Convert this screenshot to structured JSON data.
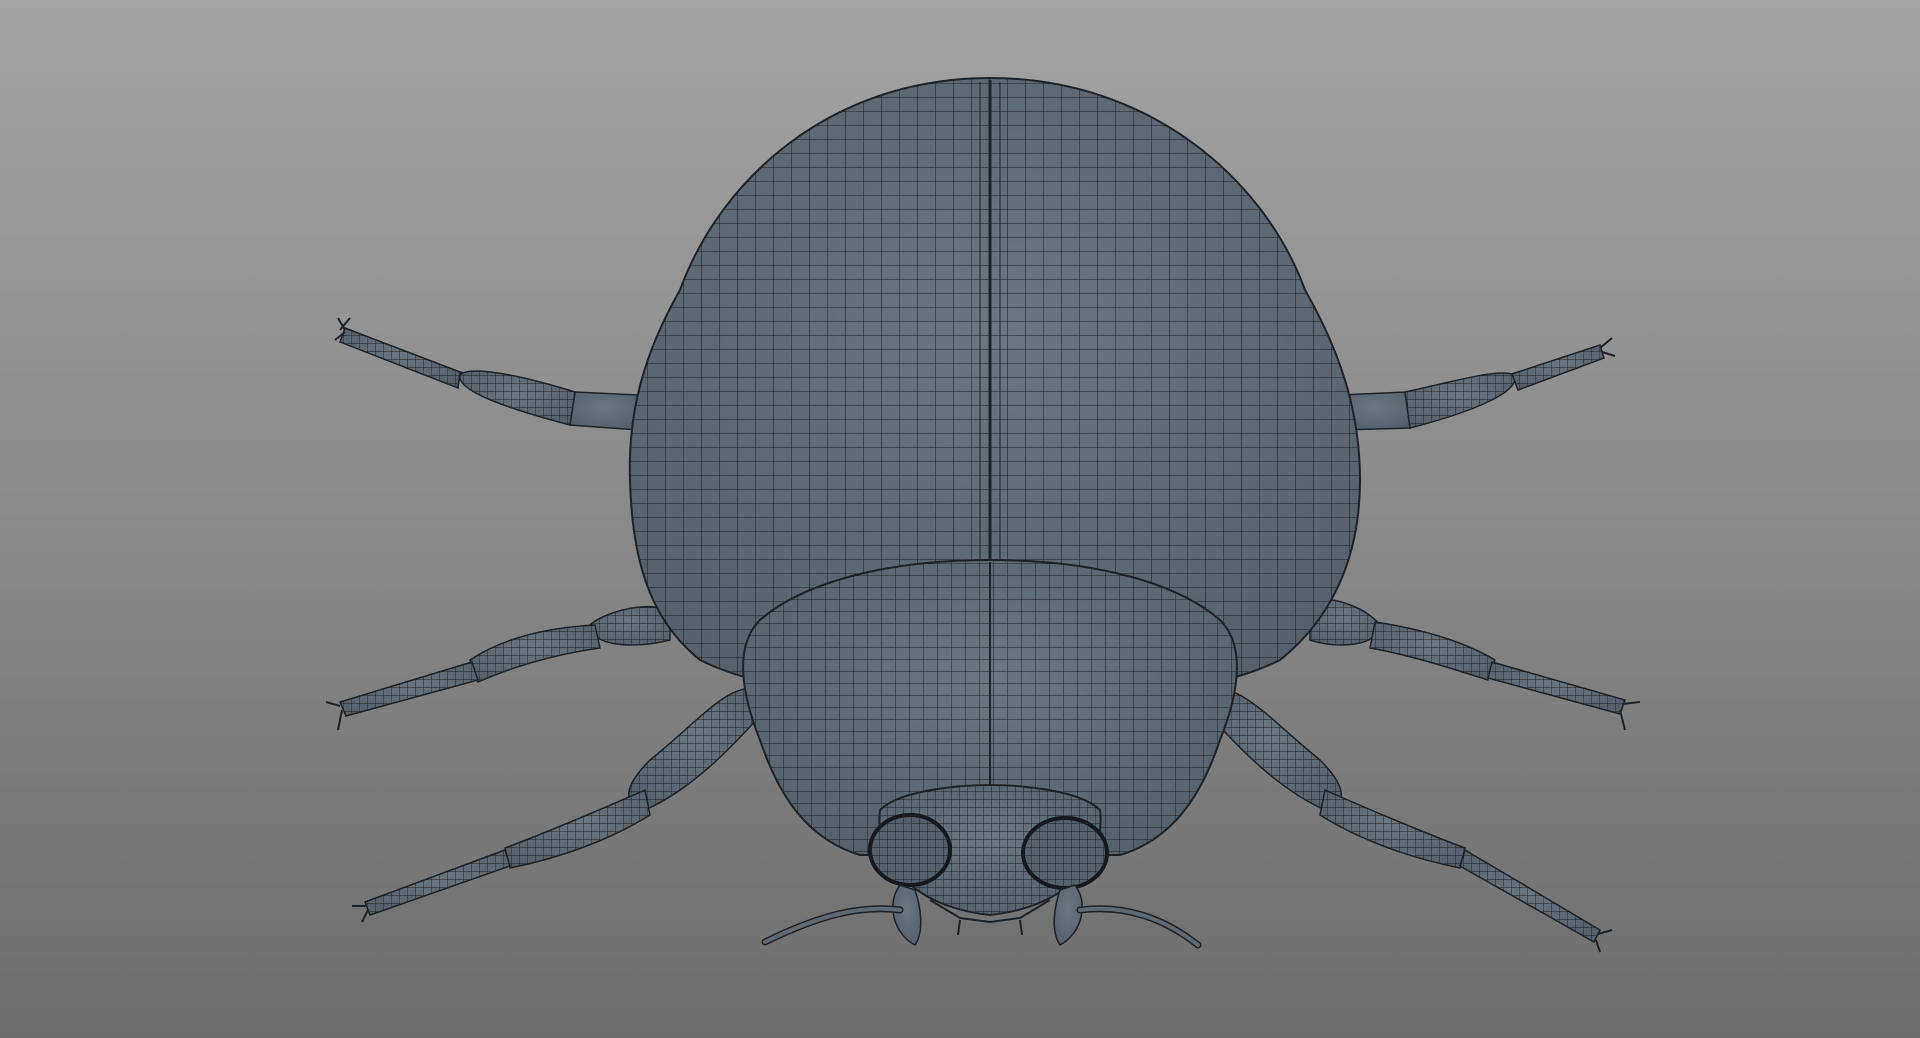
{
  "viewport": {
    "mode": "wireframe-on-shaded",
    "background_top": "#a3a3a3",
    "background_bottom": "#6d6d6d"
  },
  "model": {
    "subject": "beetle-mesh",
    "surface_color": "#5f6a73",
    "wire_color": "#1e2328"
  }
}
